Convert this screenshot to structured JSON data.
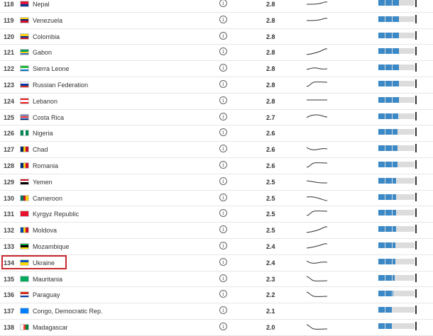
{
  "rows": [
    {
      "rank": "118",
      "country": "Nepal",
      "score": "2.8",
      "level": 0.57,
      "flag": {
        "dir": "v",
        "colors": [
          "#dc143c",
          "#003893"
        ]
      },
      "trend": "flat-rise"
    },
    {
      "rank": "119",
      "country": "Venezuela",
      "score": "2.8",
      "level": 0.57,
      "flag": {
        "dir": "v",
        "colors": [
          "#ffcc00",
          "#00247d",
          "#cf142b"
        ]
      },
      "trend": "flat-rise"
    },
    {
      "rank": "120",
      "country": "Colombia",
      "score": "2.8",
      "level": 0.57,
      "flag": {
        "dir": "v",
        "colors": [
          "#fcd116",
          "#fcd116",
          "#003893",
          "#ce1126"
        ]
      },
      "trend": "none"
    },
    {
      "rank": "121",
      "country": "Gabon",
      "score": "2.8",
      "level": 0.57,
      "flag": {
        "dir": "v",
        "colors": [
          "#009e60",
          "#fcd116",
          "#3a75c4"
        ]
      },
      "trend": "rise"
    },
    {
      "rank": "122",
      "country": "Sierra Leone",
      "score": "2.8",
      "level": 0.57,
      "flag": {
        "dir": "v",
        "colors": [
          "#1eb53a",
          "#ffffff",
          "#0072c6"
        ]
      },
      "trend": "wave"
    },
    {
      "rank": "123",
      "country": "Russian Federation",
      "score": "2.8",
      "level": 0.57,
      "flag": {
        "dir": "v",
        "colors": [
          "#ffffff",
          "#0039a6",
          "#d52b1e"
        ]
      },
      "trend": "step-rise"
    },
    {
      "rank": "124",
      "country": "Lebanon",
      "score": "2.8",
      "level": 0.57,
      "flag": {
        "dir": "v",
        "colors": [
          "#ed1c24",
          "#ffffff",
          "#ffffff",
          "#ed1c24"
        ]
      },
      "trend": "flat"
    },
    {
      "rank": "125",
      "country": "Costa Rica",
      "score": "2.7",
      "level": 0.55,
      "flag": {
        "dir": "v",
        "colors": [
          "#002b7f",
          "#ffffff",
          "#ce1126",
          "#ce1126",
          "#ffffff",
          "#002b7f"
        ]
      },
      "trend": "hump"
    },
    {
      "rank": "126",
      "country": "Nigeria",
      "score": "2.6",
      "level": 0.52,
      "flag": {
        "dir": "h",
        "colors": [
          "#008751",
          "#ffffff",
          "#008751"
        ]
      },
      "trend": "none"
    },
    {
      "rank": "127",
      "country": "Chad",
      "score": "2.6",
      "level": 0.52,
      "flag": {
        "dir": "h",
        "colors": [
          "#002664",
          "#fecb00",
          "#c60c30"
        ]
      },
      "trend": "dip"
    },
    {
      "rank": "128",
      "country": "Romania",
      "score": "2.6",
      "level": 0.52,
      "flag": {
        "dir": "h",
        "colors": [
          "#002b7f",
          "#fcd116",
          "#ce1126"
        ]
      },
      "trend": "step-rise"
    },
    {
      "rank": "129",
      "country": "Yemen",
      "score": "2.5",
      "level": 0.5,
      "flag": {
        "dir": "v",
        "colors": [
          "#ce1126",
          "#ffffff",
          "#000000"
        ]
      },
      "trend": "flat-wave"
    },
    {
      "rank": "130",
      "country": "Cameroon",
      "score": "2.5",
      "level": 0.5,
      "flag": {
        "dir": "h",
        "colors": [
          "#007a5e",
          "#ce1126",
          "#fcd116"
        ]
      },
      "trend": "hump-fall"
    },
    {
      "rank": "131",
      "country": "Kyrgyz Republic",
      "score": "2.5",
      "level": 0.5,
      "flag": {
        "dir": "v",
        "colors": [
          "#e8112d"
        ]
      },
      "trend": "step-rise"
    },
    {
      "rank": "132",
      "country": "Moldova",
      "score": "2.5",
      "level": 0.5,
      "flag": {
        "dir": "h",
        "colors": [
          "#0046ae",
          "#ffd200",
          "#cc092f"
        ]
      },
      "trend": "rise"
    },
    {
      "rank": "133",
      "country": "Mozambique",
      "score": "2.4",
      "level": 0.48,
      "flag": {
        "dir": "v",
        "colors": [
          "#009a44",
          "#000000",
          "#fce100"
        ]
      },
      "trend": "rise-soft"
    },
    {
      "rank": "134",
      "country": "Ukraine",
      "score": "2.4",
      "level": 0.48,
      "flag": {
        "dir": "v",
        "colors": [
          "#0057b7",
          "#ffd700"
        ]
      },
      "trend": "dip"
    },
    {
      "rank": "135",
      "country": "Mauritania",
      "score": "2.3",
      "level": 0.45,
      "flag": {
        "dir": "v",
        "colors": [
          "#00a95c"
        ]
      },
      "trend": "drop"
    },
    {
      "rank": "136",
      "country": "Paraguay",
      "score": "2.2",
      "level": 0.42,
      "flag": {
        "dir": "v",
        "colors": [
          "#d52b1e",
          "#ffffff",
          "#0038a8"
        ]
      },
      "trend": "drop"
    },
    {
      "rank": "137",
      "country": "Congo, Democratic Rep.",
      "score": "2.1",
      "level": 0.4,
      "flag": {
        "dir": "v",
        "colors": [
          "#007fff"
        ]
      },
      "trend": "none"
    },
    {
      "rank": "138",
      "country": "Madagascar",
      "score": "2.0",
      "level": 0.38,
      "flag": {
        "dir": "h",
        "colors": [
          "#ffffff",
          "#fc3d32",
          "#007e3a"
        ]
      },
      "trend": "drop"
    }
  ],
  "highlighted_rank": "134",
  "colors": {
    "bar_fill": "#3b88c6",
    "bar_bg": "#dcdcdc",
    "highlight_border": "#c8272d"
  },
  "icons": {
    "info": "info-circle-icon"
  }
}
